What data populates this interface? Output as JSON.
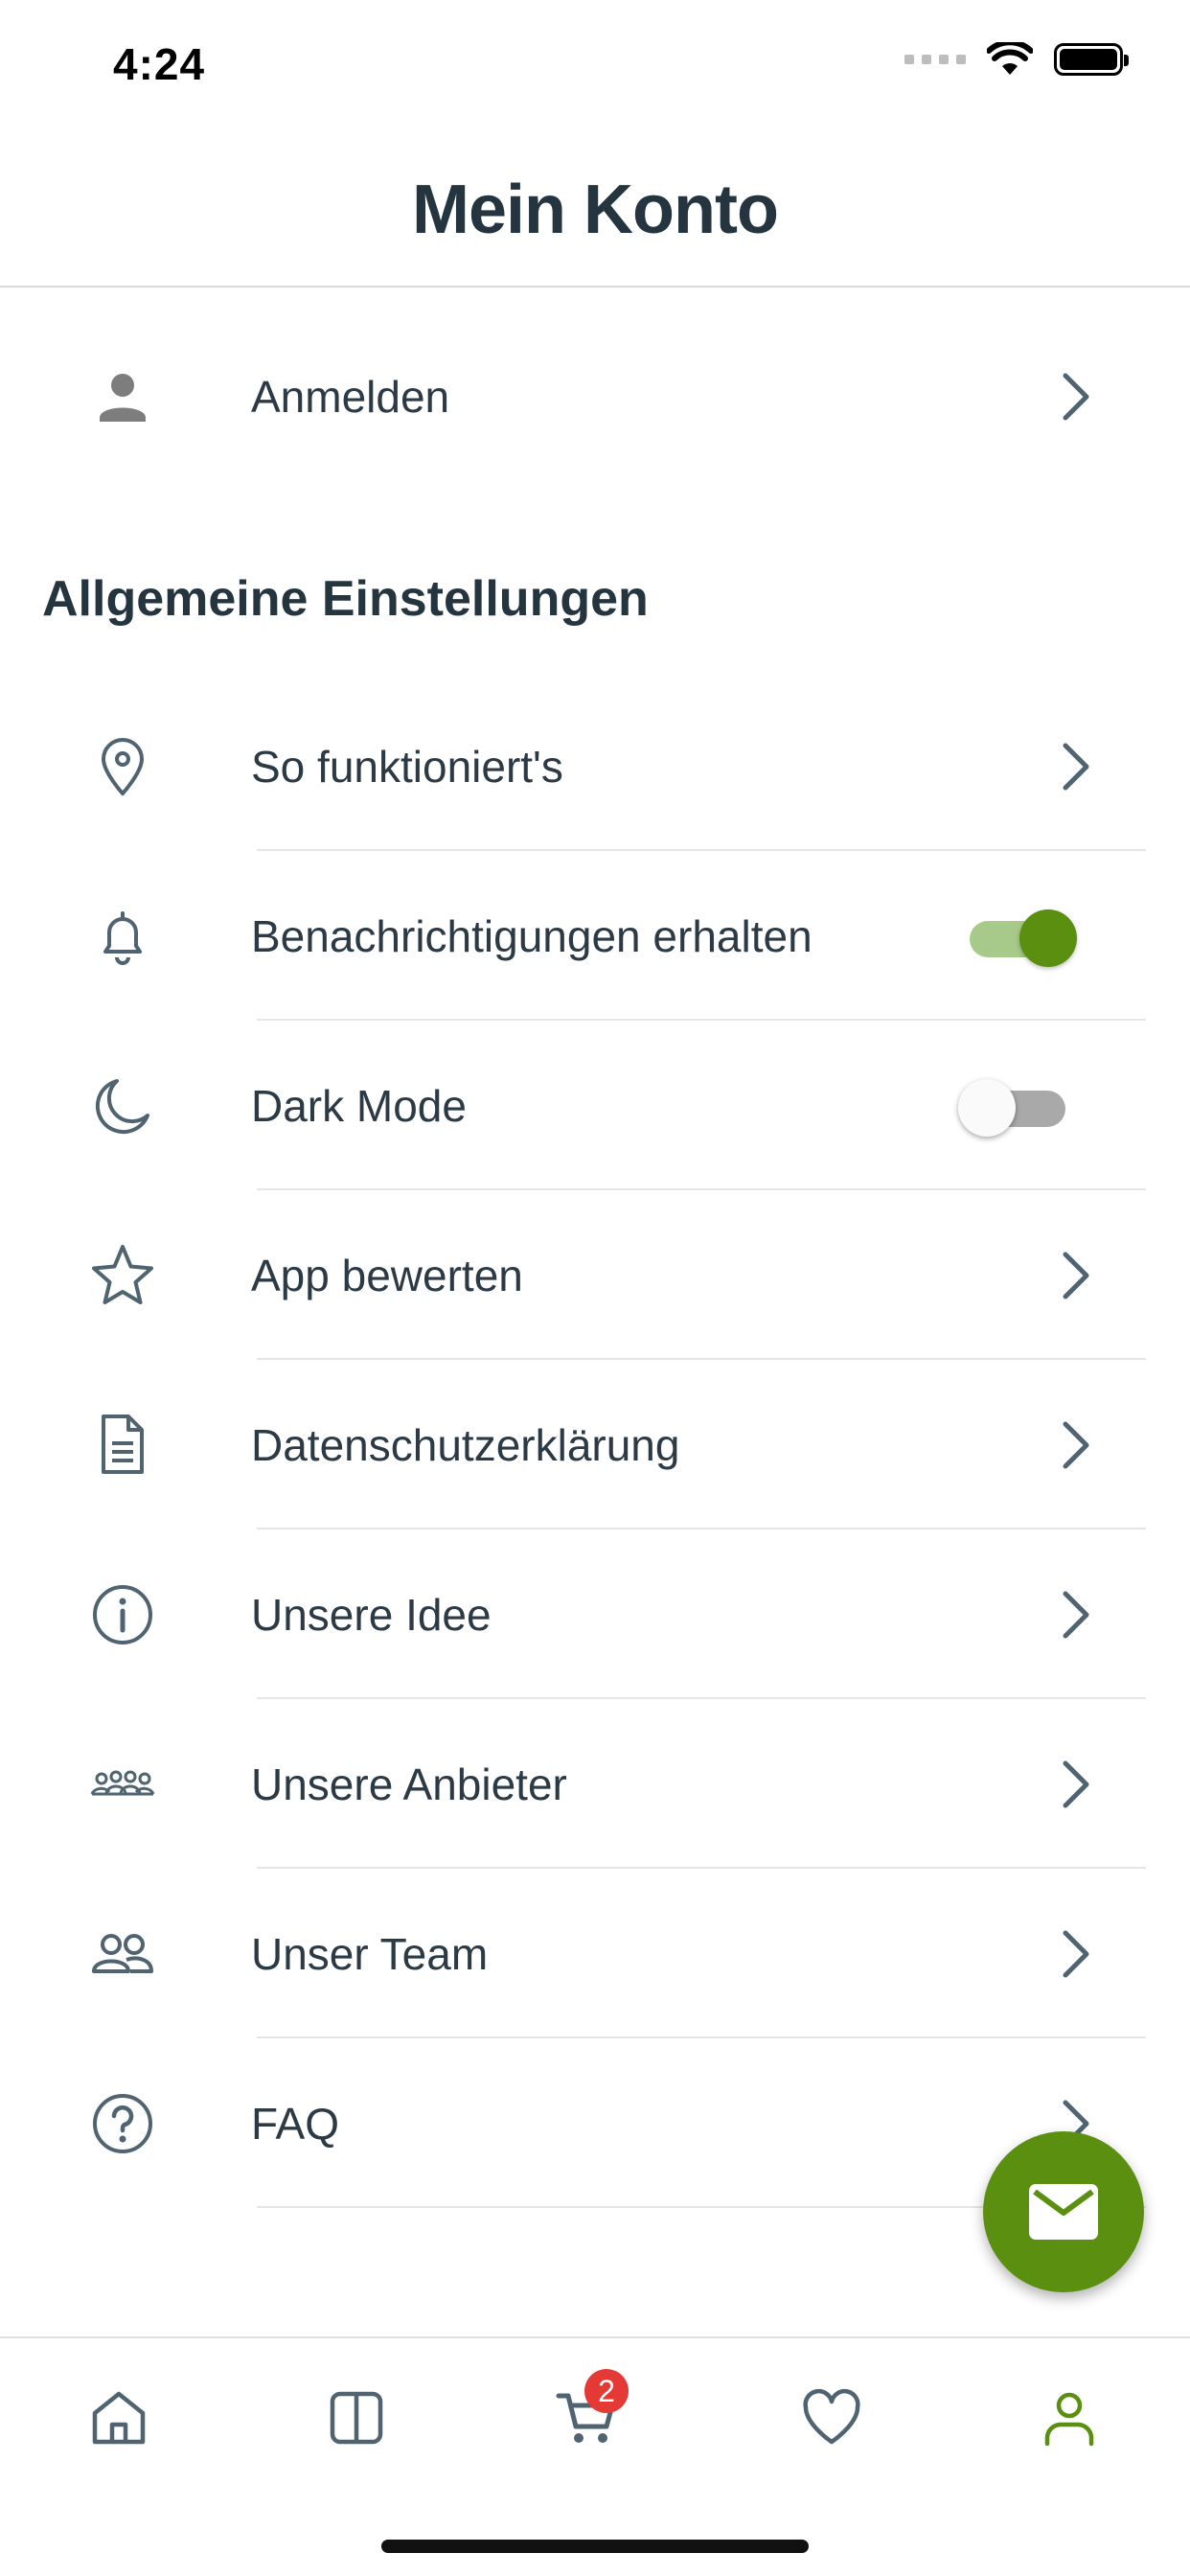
{
  "status_bar": {
    "time": "4:24"
  },
  "header": {
    "title": "Mein Konto"
  },
  "login": {
    "label": "Anmelden"
  },
  "section": {
    "title": "Allgemeine Einstellungen"
  },
  "settings": [
    {
      "label": "So funktioniert's",
      "icon": "location-pin-icon",
      "control": "chevron"
    },
    {
      "label": "Benachrichtigungen erhalten",
      "icon": "bell-icon",
      "control": "toggle",
      "on": true
    },
    {
      "label": "Dark Mode",
      "icon": "moon-icon",
      "control": "toggle",
      "on": false
    },
    {
      "label": "App bewerten",
      "icon": "star-icon",
      "control": "chevron"
    },
    {
      "label": "Datenschutzerklärung",
      "icon": "document-icon",
      "control": "chevron"
    },
    {
      "label": "Unsere Idee",
      "icon": "info-icon",
      "control": "chevron"
    },
    {
      "label": "Unsere Anbieter",
      "icon": "group-icon",
      "control": "chevron"
    },
    {
      "label": "Unser Team",
      "icon": "team-icon",
      "control": "chevron"
    },
    {
      "label": "FAQ",
      "icon": "question-icon",
      "control": "chevron"
    }
  ],
  "fab": {
    "icon": "mail-icon"
  },
  "tabbar": {
    "tabs": [
      {
        "icon": "home-icon"
      },
      {
        "icon": "catalog-icon"
      },
      {
        "icon": "cart-icon",
        "badge": "2"
      },
      {
        "icon": "heart-icon"
      },
      {
        "icon": "account-icon",
        "active": true
      }
    ]
  },
  "colors": {
    "accent": "#5a8f0f",
    "toggle_track_on": "#a7c98a",
    "text": "#2b3a45",
    "icon": "#4f6470",
    "badge": "#e53935"
  }
}
